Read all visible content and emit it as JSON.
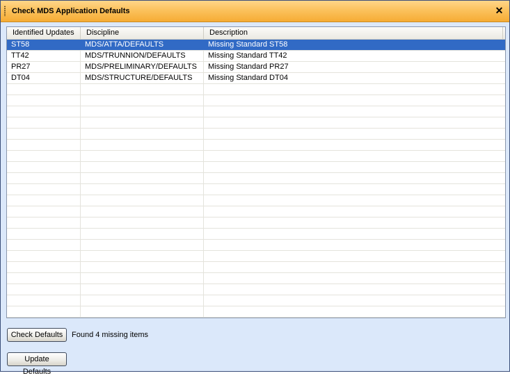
{
  "window": {
    "title": "Check MDS Application Defaults",
    "close_symbol": "✕"
  },
  "grid": {
    "columns": [
      "Identified Updates",
      "Discipline",
      "Description"
    ],
    "rows": [
      {
        "id": "ST58",
        "discipline": "MDS/ATTA/DEFAULTS",
        "description": "Missing Standard ST58",
        "selected": true
      },
      {
        "id": "TT42",
        "discipline": "MDS/TRUNNION/DEFAULTS",
        "description": "Missing Standard TT42",
        "selected": false
      },
      {
        "id": "PR27",
        "discipline": "MDS/PRELIMINARY/DEFAULTS",
        "description": "Missing Standard PR27",
        "selected": false
      },
      {
        "id": "DT04",
        "discipline": "MDS/STRUCTURE/DEFAULTS",
        "description": "Missing Standard DT04",
        "selected": false
      }
    ],
    "selection_color": "#316ac5"
  },
  "footer": {
    "check_button": "Check Defaults",
    "status_text": "Found 4 missing items",
    "update_button": "Update Defaults"
  }
}
